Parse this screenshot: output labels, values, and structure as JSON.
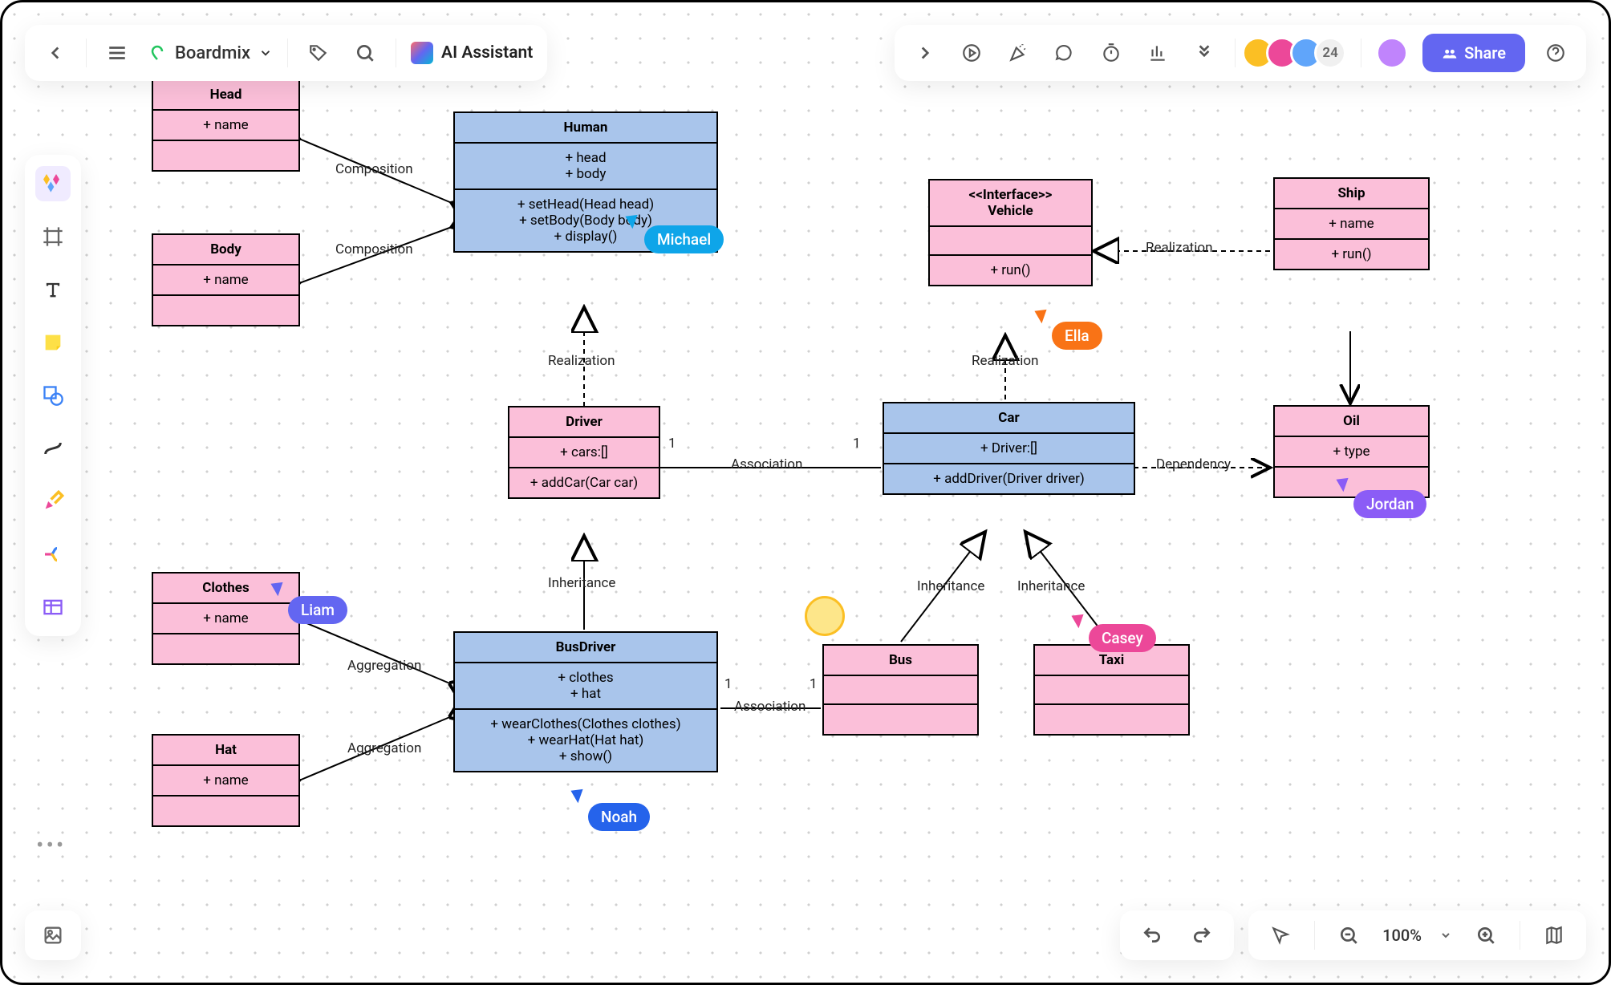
{
  "header": {
    "title": "Boardmix",
    "ai": "AI Assistant",
    "collaborators": "24",
    "share": "Share"
  },
  "footer": {
    "zoom": "100%"
  },
  "mult": {
    "one": "1"
  },
  "rels": {
    "composition": "Composition",
    "realization": "Realization",
    "inheritance": "Inheritance",
    "aggregation": "Aggregation",
    "association": "Association",
    "dependency": "Dependency"
  },
  "classes": {
    "head": {
      "name": "Head",
      "attr": "+ name"
    },
    "body": {
      "name": "Body",
      "attr": "+ name"
    },
    "human": {
      "name": "Human",
      "attrs": [
        "+ head",
        "+ body"
      ],
      "ops": [
        "+ setHead(Head head)",
        "+ setBody(Body body)",
        "+ display()"
      ]
    },
    "driver": {
      "name": "Driver",
      "attr": "+ cars:[]",
      "op": "+ addCar(Car car)"
    },
    "busdriver": {
      "name": "BusDriver",
      "attrs": [
        "+ clothes",
        "+ hat"
      ],
      "ops": [
        "+ wearClothes(Clothes clothes)",
        "+ wearHat(Hat hat)",
        "+ show()"
      ]
    },
    "clothes": {
      "name": "Clothes",
      "attr": "+ name"
    },
    "hat": {
      "name": "Hat",
      "attr": "+ name"
    },
    "vehicle": {
      "stereo": "<<Interface>>",
      "name": "Vehicle",
      "op": "+ run()"
    },
    "car": {
      "name": "Car",
      "attr": "+ Driver:[]",
      "op": "+ addDriver(Driver driver)"
    },
    "bus": {
      "name": "Bus"
    },
    "taxi": {
      "name": "Taxi"
    },
    "ship": {
      "name": "Ship",
      "attr": "+ name",
      "op": "+ run()"
    },
    "oil": {
      "name": "Oil",
      "attr": "+ type"
    }
  },
  "cursors": [
    {
      "name": "Michael",
      "color": "#0ea5e9"
    },
    {
      "name": "Ella",
      "color": "#f97316"
    },
    {
      "name": "Jordan",
      "color": "#8b5cf6"
    },
    {
      "name": "Liam",
      "color": "#6366f1"
    },
    {
      "name": "Noah",
      "color": "#2563eb"
    },
    {
      "name": "Casey",
      "color": "#ec4899"
    }
  ]
}
